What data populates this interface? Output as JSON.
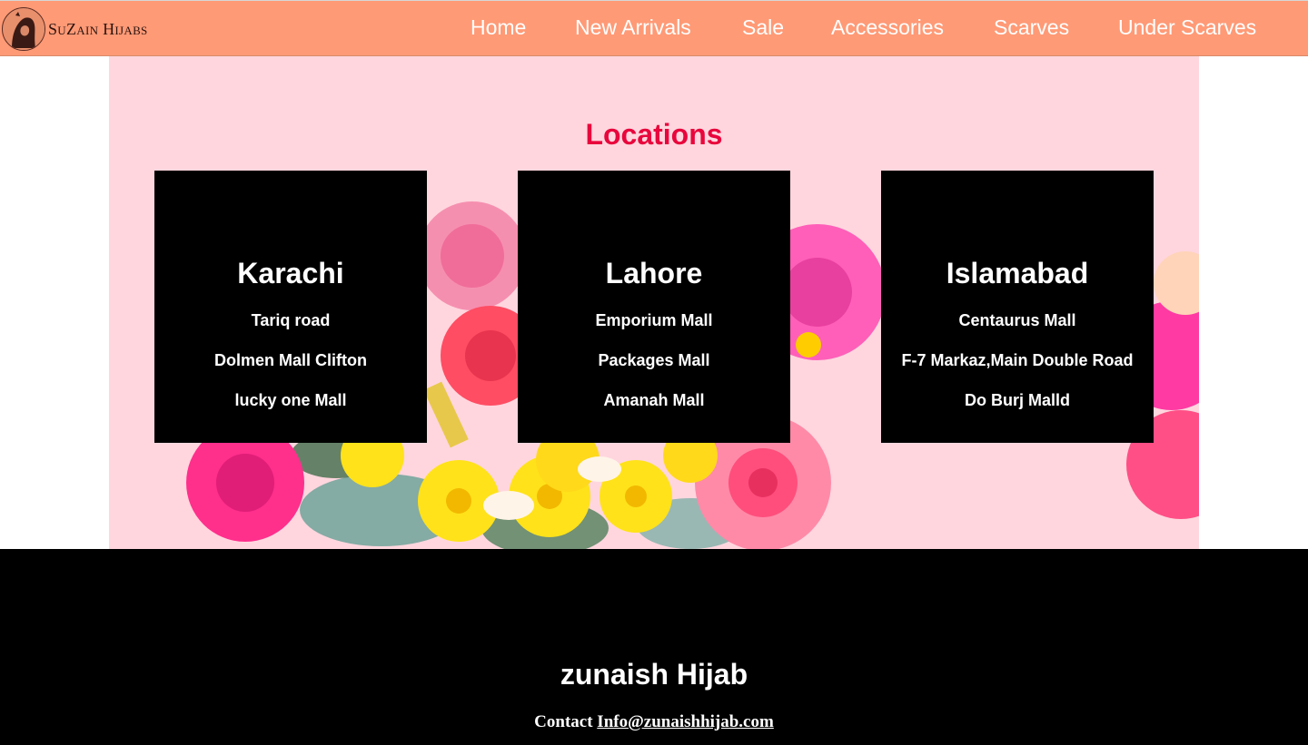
{
  "brand": {
    "logo_text": "SuZain Hijabs"
  },
  "nav": {
    "items": [
      "Home",
      "New Arrivals",
      "Sale",
      "Accessories",
      "Scarves",
      "Under Scarves"
    ]
  },
  "locations": {
    "title": "Locations",
    "cities": [
      {
        "name": "Karachi",
        "places": [
          "Tariq road",
          "Dolmen Mall Clifton",
          "lucky one Mall"
        ]
      },
      {
        "name": "Lahore",
        "places": [
          "Emporium Mall",
          "Packages Mall",
          "Amanah Mall"
        ]
      },
      {
        "name": "Islamabad",
        "places": [
          "Centaurus Mall",
          "F-7 Markaz,Main Double Road",
          "Do Burj Malld"
        ]
      }
    ]
  },
  "footer": {
    "brand": "zunaish Hijab",
    "contact_label": "Contact",
    "email": "Info@zunaishhijab.com"
  },
  "colors": {
    "navbar": "#ff9a76",
    "hero_background": "#ffd6de",
    "title_accent": "#e8063c",
    "card_background": "#000000",
    "footer_background": "#000000"
  }
}
